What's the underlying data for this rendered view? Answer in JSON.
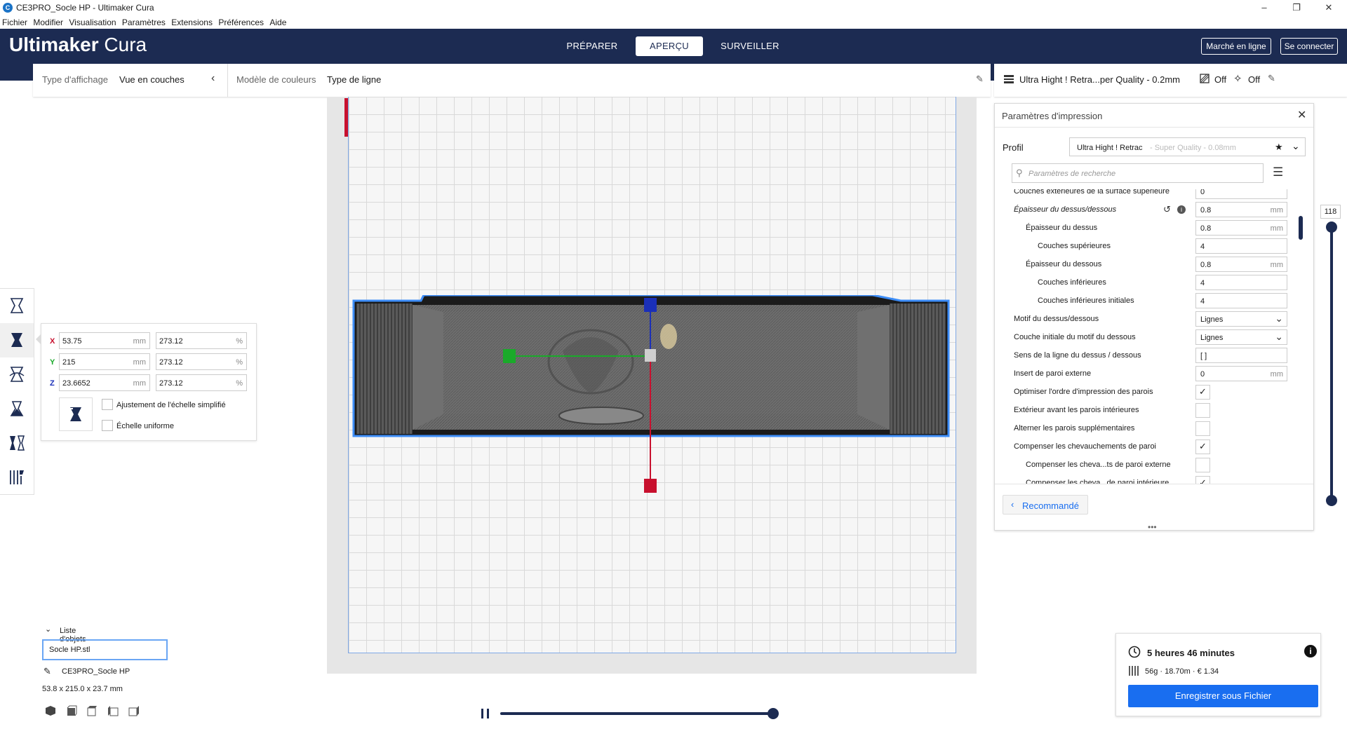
{
  "window": {
    "title": "CE3PRO_Socle HP - Ultimaker Cura",
    "app_icon": "cura-logo"
  },
  "menu": [
    "Fichier",
    "Modifier",
    "Visualisation",
    "Paramètres",
    "Extensions",
    "Préférences",
    "Aide"
  ],
  "header": {
    "brand_bold": "Ultimaker",
    "brand_light": "Cura",
    "tabs": [
      {
        "label": "PRÉPARER",
        "active": false
      },
      {
        "label": "APERÇU",
        "active": true
      },
      {
        "label": "SURVEILLER",
        "active": false
      }
    ],
    "marketplace": "Marché en ligne",
    "signin": "Se connecter"
  },
  "viewbar": {
    "display_type_label": "Type d'affichage",
    "display_type_value": "Vue en couches",
    "color_scheme_label": "Modèle de couleurs",
    "color_scheme_value": "Type de ligne"
  },
  "printbar": {
    "profile": "Ultra Hight ! Retra...per Quality - 0.2mm",
    "support": "Off",
    "adhesion": "Off"
  },
  "scale": {
    "x_mm": "53.75",
    "y_mm": "215",
    "z_mm": "23.6652",
    "x_pct": "273.12",
    "y_pct": "273.12",
    "z_pct": "273.12",
    "unit_mm": "mm",
    "unit_pct": "%",
    "snap_label": "Ajustement de l'échelle simplifié",
    "uniform_label": "Échelle uniforme"
  },
  "objects": {
    "title": "Liste d'objets",
    "file": "Socle HP.stl",
    "project": "CE3PRO_Socle HP",
    "dims": "53.8 x 215.0 x 23.7 mm"
  },
  "settings": {
    "title": "Paramètres d'impression",
    "profile_label": "Profil",
    "profile_name": "Ultra Hight ! Retrac",
    "profile_sub": " - Super Quality - 0.08mm",
    "search_placeholder": "Paramètres de recherche",
    "rows": [
      {
        "label": "Couches extérieures de la surface supérieure",
        "indent": 0,
        "type": "text",
        "value": "0",
        "unit": ""
      },
      {
        "label": "Épaisseur du dessus/dessous",
        "indent": 0,
        "type": "text",
        "value": "0.8",
        "unit": "mm",
        "italic": true
      },
      {
        "label": "Épaisseur du dessus",
        "indent": 1,
        "type": "text",
        "value": "0.8",
        "unit": "mm"
      },
      {
        "label": "Couches supérieures",
        "indent": 2,
        "type": "text",
        "value": "4",
        "unit": ""
      },
      {
        "label": "Épaisseur du dessous",
        "indent": 1,
        "type": "text",
        "value": "0.8",
        "unit": "mm"
      },
      {
        "label": "Couches inférieures",
        "indent": 2,
        "type": "text",
        "value": "4",
        "unit": ""
      },
      {
        "label": "Couches inférieures initiales",
        "indent": 2,
        "type": "text",
        "value": "4",
        "unit": ""
      },
      {
        "label": "Motif du dessus/dessous",
        "indent": 0,
        "type": "select",
        "value": "Lignes",
        "unit": ""
      },
      {
        "label": "Couche initiale du motif du dessous",
        "indent": 0,
        "type": "select",
        "value": "Lignes",
        "unit": ""
      },
      {
        "label": "Sens de la ligne du dessus / dessous",
        "indent": 0,
        "type": "text",
        "value": "[ ]",
        "unit": ""
      },
      {
        "label": "Insert de paroi externe",
        "indent": 0,
        "type": "text",
        "value": "0",
        "unit": "mm"
      },
      {
        "label": "Optimiser l'ordre d'impression des parois",
        "indent": 0,
        "type": "check",
        "checked": true
      },
      {
        "label": "Extérieur avant les parois intérieures",
        "indent": 0,
        "type": "check",
        "checked": false
      },
      {
        "label": "Alterner les parois supplémentaires",
        "indent": 0,
        "type": "check",
        "checked": false
      },
      {
        "label": "Compenser les chevauchements de paroi",
        "indent": 0,
        "type": "check",
        "checked": true
      },
      {
        "label": "Compenser les cheva...ts de paroi externe",
        "indent": 1,
        "type": "check",
        "checked": false
      },
      {
        "label": "Compenser les cheva...de paroi intérieure",
        "indent": 1,
        "type": "check",
        "checked": true
      }
    ],
    "recommended": "Recommandé"
  },
  "layer_slider": {
    "value": "118"
  },
  "summary": {
    "time": "5 heures 46 minutes",
    "material": "56g · 18.70m · € 1.34",
    "save": "Enregistrer sous Fichier"
  },
  "colors": {
    "header": "#1c2b52",
    "accent": "#196ef0",
    "x_axis": "#c8102e",
    "y_axis": "#1aaa2a",
    "z_axis": "#1a2fb8"
  }
}
